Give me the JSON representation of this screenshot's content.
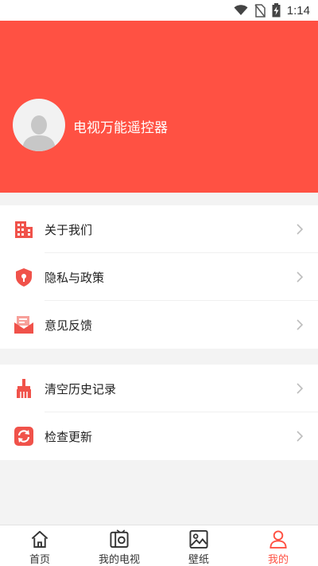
{
  "status_bar": {
    "time": "1:14",
    "icons": [
      "wifi-icon",
      "no-sim-icon",
      "battery-charging-icon"
    ]
  },
  "profile": {
    "app_name": "电视万能遥控器",
    "avatar_icon": "default-avatar-icon"
  },
  "menu_group_1": [
    {
      "label": "关于我们",
      "icon": "building-icon"
    },
    {
      "label": "隐私与政策",
      "icon": "shield-icon"
    },
    {
      "label": "意见反馈",
      "icon": "mail-icon"
    }
  ],
  "menu_group_2": [
    {
      "label": "清空历史记录",
      "icon": "broom-icon"
    },
    {
      "label": "检查更新",
      "icon": "refresh-icon"
    }
  ],
  "tabbar": {
    "tabs": [
      {
        "label": "首页",
        "icon": "home-icon",
        "active": false
      },
      {
        "label": "我的电视",
        "icon": "tv-icon",
        "active": false
      },
      {
        "label": "壁纸",
        "icon": "image-icon",
        "active": false
      },
      {
        "label": "我的",
        "icon": "user-icon",
        "active": true
      }
    ]
  },
  "colors": {
    "accent": "#ff5143",
    "icon_red": "#f0524a",
    "background": "#f3f3f3"
  }
}
